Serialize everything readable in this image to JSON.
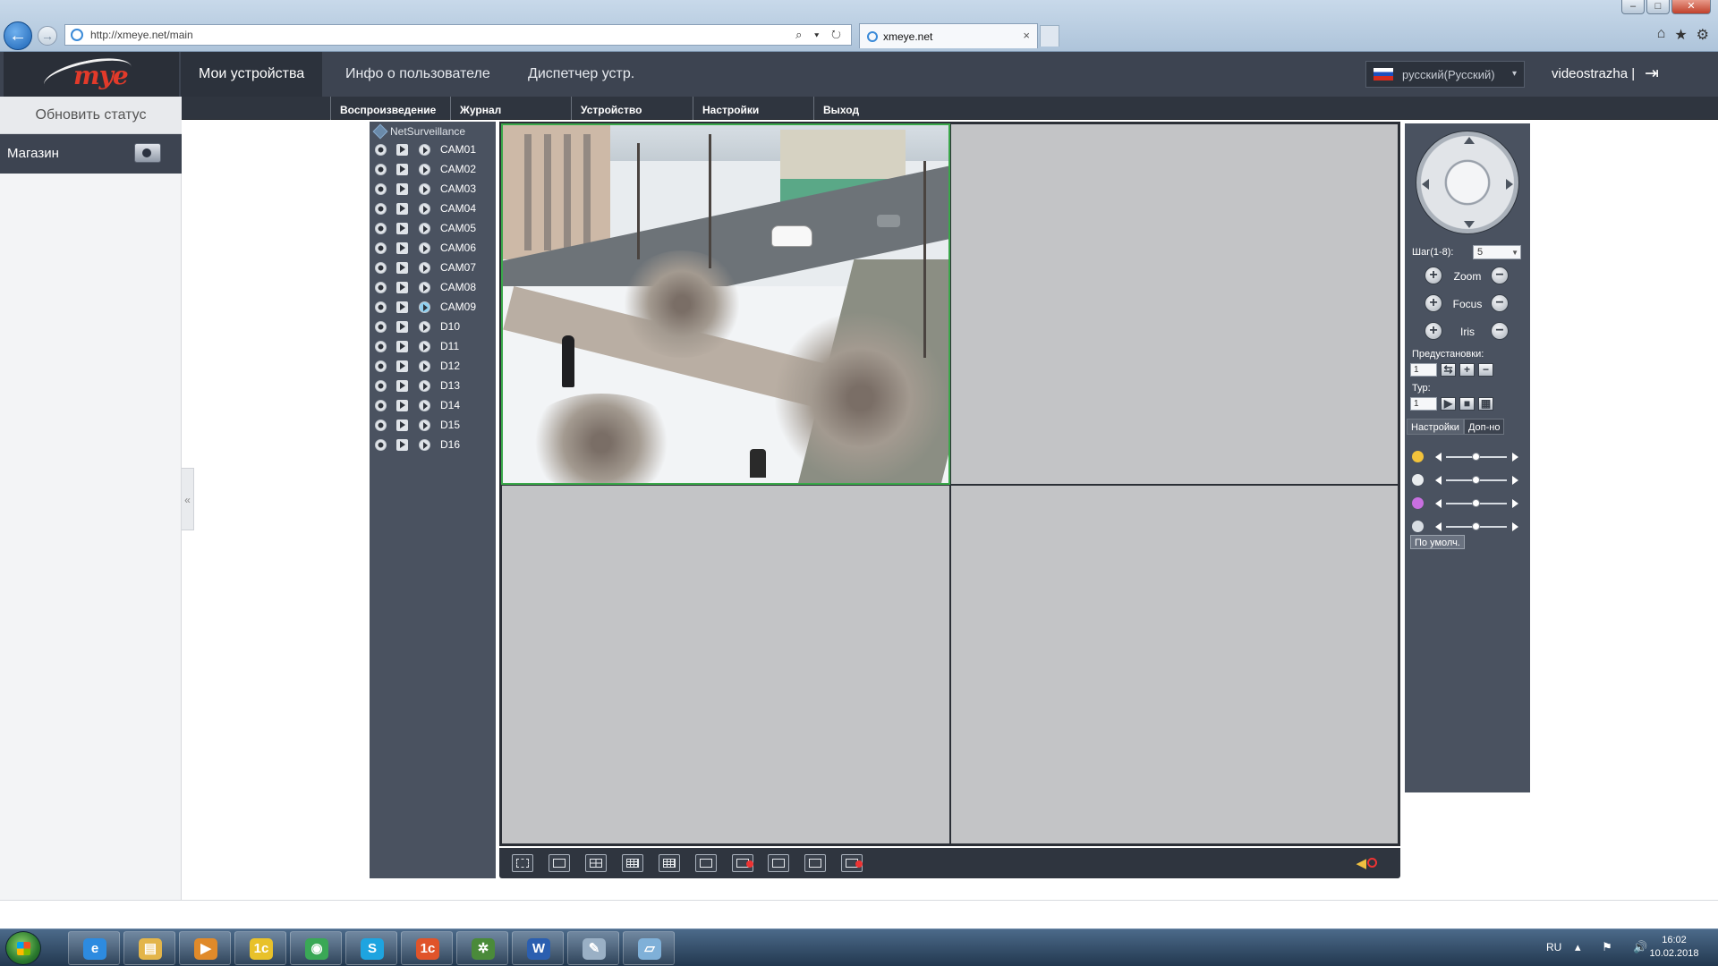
{
  "browser": {
    "url": "http://xmeye.net/main",
    "tab_title": "xmeye.net",
    "tab_close": "×",
    "back_glyph": "←",
    "forward_glyph": "→",
    "address_tools": "⌕ ▾ ↻",
    "window_controls": {
      "minimize": "–",
      "maximize": "□",
      "close": "✕"
    },
    "toolbar_icons": {
      "home": "⌂",
      "favorites": "★",
      "settings": "⚙"
    }
  },
  "app": {
    "logo": "mye",
    "main_tabs": [
      {
        "label": "Мои устройства",
        "active": true
      },
      {
        "label": "Инфо о пользователе",
        "active": false
      },
      {
        "label": "Диспетчер устр.",
        "active": false
      }
    ],
    "language": "русский(Русский)",
    "language_arrow": "▾",
    "username": "videostrazha |",
    "logout_glyph": "⇥",
    "sub_menu": [
      "Воспроизведение",
      "Журнал",
      "Устройство",
      "Настройки",
      "Выход"
    ]
  },
  "sidebar": {
    "refresh_label": "Обновить статус",
    "device_name": "Магазин",
    "collapse_glyph": "«"
  },
  "channels": {
    "root": "NetSurveillance",
    "items": [
      "CAM01",
      "CAM02",
      "CAM03",
      "CAM04",
      "CAM05",
      "CAM06",
      "CAM07",
      "CAM08",
      "CAM09",
      "D10",
      "D11",
      "D12",
      "D13",
      "D14",
      "D15",
      "D16"
    ],
    "active_channel": "CAM09"
  },
  "toolbar": {
    "volume_glyph": "◀"
  },
  "ptz": {
    "step_label": "Шаг(1-8):",
    "step_value": "5",
    "rows": [
      {
        "label": "Zoom",
        "plus": "+",
        "minus": "−"
      },
      {
        "label": "Focus",
        "plus": "+",
        "minus": "−"
      },
      {
        "label": "Iris",
        "plus": "+",
        "minus": "−"
      }
    ],
    "preset_label": "Предустановки:",
    "preset_value": "1",
    "preset_buttons": {
      "go": "⇆",
      "add": "+",
      "remove": "−"
    },
    "tour_label": "Тур:",
    "tour_value": "1",
    "tour_buttons": {
      "play": "▶",
      "stop": "■",
      "grid": "▦"
    },
    "tabs": [
      "Настройки",
      "Доп-но"
    ],
    "sliders": [
      {
        "icon": "brightness",
        "color": "#f3c33b",
        "value": 0.5
      },
      {
        "icon": "contrast",
        "color": "#e9ecef",
        "value": 0.5
      },
      {
        "icon": "saturation",
        "color": "#c86fe0",
        "value": 0.5
      },
      {
        "icon": "hue",
        "color": "#d8dde3",
        "value": 0.5
      }
    ],
    "default_label": "По умолч."
  },
  "taskbar": {
    "apps": [
      {
        "name": "ie",
        "glyph": "e",
        "color": "#2d8be0"
      },
      {
        "name": "explorer",
        "glyph": "▤",
        "color": "#e3b54a"
      },
      {
        "name": "media-player",
        "glyph": "▶",
        "color": "#e08a2a"
      },
      {
        "name": "1c",
        "glyph": "1с",
        "color": "#e8c12a"
      },
      {
        "name": "chrome",
        "glyph": "◉",
        "color": "#3aa856"
      },
      {
        "name": "skype",
        "glyph": "S",
        "color": "#1ea4e0"
      },
      {
        "name": "1c-enterprise",
        "glyph": "1с",
        "color": "#e0542a"
      },
      {
        "name": "app-green",
        "glyph": "✲",
        "color": "#4a8a3a"
      },
      {
        "name": "word",
        "glyph": "W",
        "color": "#2b5fb0"
      },
      {
        "name": "paint",
        "glyph": "✎",
        "color": "#9ab0c5"
      },
      {
        "name": "notepad",
        "glyph": "▱",
        "color": "#7fb0d8"
      }
    ],
    "tray_lang": "RU",
    "tray_icons": "▴ ⚑ 🔊",
    "time": "16:02",
    "date": "10.02.2018"
  },
  "colors": {
    "header_bg": "#3d4451",
    "panel_bg": "#4a5260",
    "video_bg": "#c3c4c6",
    "selected_cell": "#3aa84a",
    "logo_red": "#e23a2a"
  }
}
